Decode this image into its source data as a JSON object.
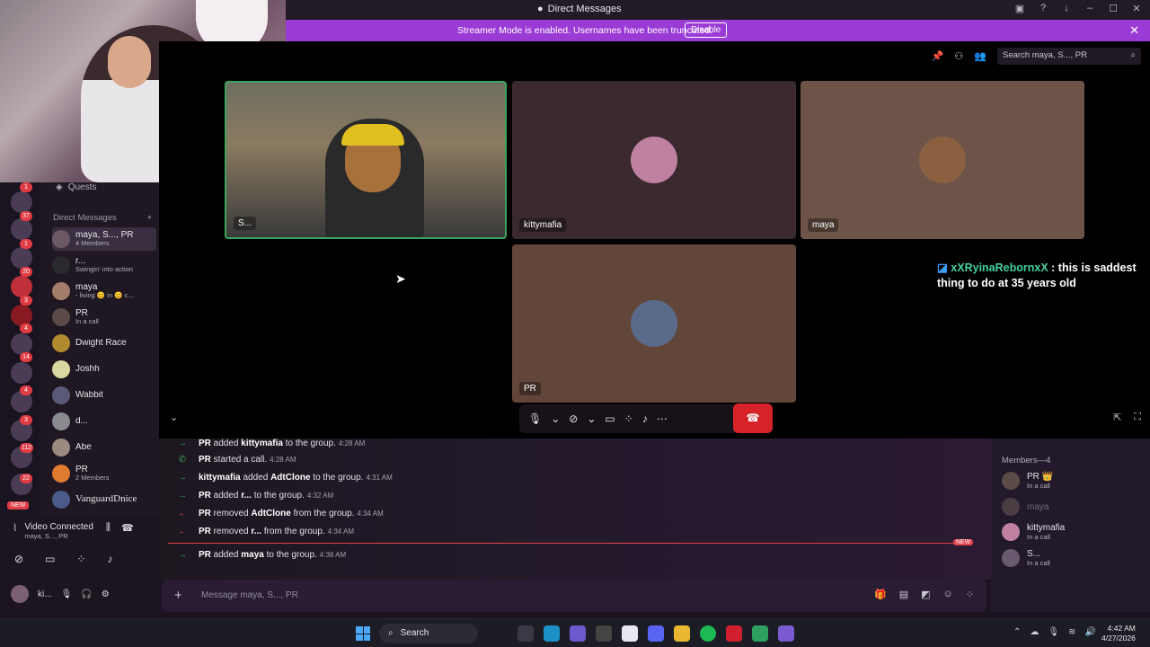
{
  "window": {
    "title": "Direct Messages"
  },
  "banner": {
    "message": "Streamer Mode is enabled. Usernames have been truncated.",
    "disable_label": "Disable"
  },
  "rail_badges": [
    "1",
    "37",
    "1",
    "20",
    "3",
    "4",
    "14",
    "4",
    "3",
    "112",
    "22"
  ],
  "rail_new_label": "NEW",
  "sidebar": {
    "quests_label": "Quests",
    "dm_header": "Direct Messages",
    "items": [
      {
        "name": "maya, S..., PR",
        "sub": "4 Members"
      },
      {
        "name": "r...",
        "sub": "Swingin' into action"
      },
      {
        "name": "maya",
        "sub": "- living 😊 in 😊 c..."
      },
      {
        "name": "PR",
        "sub": "In a call"
      },
      {
        "name": "Dwight Race",
        "sub": ""
      },
      {
        "name": "Joshh",
        "sub": ""
      },
      {
        "name": "Wabbit",
        "sub": ""
      },
      {
        "name": "d...",
        "sub": ""
      },
      {
        "name": "Abe",
        "sub": ""
      },
      {
        "name": "PR",
        "sub": "2 Members"
      },
      {
        "name": "VanguardDnice",
        "sub": ""
      }
    ]
  },
  "voice": {
    "status": "Video Connected",
    "channel": "maya, S..., PR"
  },
  "user": {
    "name": "ki..."
  },
  "call": {
    "search_placeholder": "Search maya, S..., PR",
    "tiles": [
      {
        "label": "S..."
      },
      {
        "label": "kittymafia"
      },
      {
        "label": "maya"
      },
      {
        "label": "PR"
      }
    ]
  },
  "stream_chat": {
    "user": "xXRyinaRebornxX",
    "text": " : this is saddest thing to do at 35 years old"
  },
  "messages": [
    {
      "actor": "PR",
      "action": " added ",
      "target": "kittymafia",
      "tail": " to the group.",
      "time": "4:28 AM",
      "arrow": "→"
    },
    {
      "actor": "PR",
      "action": " started a call.",
      "target": "",
      "tail": "",
      "time": "4:28 AM",
      "arrow": "✆"
    },
    {
      "actor": "kittymafia",
      "action": " added ",
      "target": "AdtClone",
      "tail": " to the group.",
      "time": "4:31 AM",
      "arrow": "→"
    },
    {
      "actor": "PR",
      "action": " added ",
      "target": "r...",
      "tail": " to the group.",
      "time": "4:32 AM",
      "arrow": "→"
    },
    {
      "actor": "PR",
      "action": " removed ",
      "target": "AdtClone",
      "tail": " from the group.",
      "time": "4:34 AM",
      "arrow": "←"
    },
    {
      "actor": "PR",
      "action": " removed ",
      "target": "r...",
      "tail": " from the group.",
      "time": "4:34 AM",
      "arrow": "←"
    },
    {
      "actor": "PR",
      "action": " added ",
      "target": "maya",
      "tail": " to the group.",
      "time": "4:38 AM",
      "arrow": "→"
    }
  ],
  "new_label": "NEW",
  "composer": {
    "placeholder": "Message maya, S..., PR"
  },
  "members": {
    "header": "Members—4",
    "list": [
      {
        "name": "PR 👑",
        "sub": "In a call"
      },
      {
        "name": "maya",
        "sub": ""
      },
      {
        "name": "kittymafia",
        "sub": "In a call"
      },
      {
        "name": "S...",
        "sub": "In a call"
      }
    ]
  },
  "taskbar": {
    "search_label": "Search",
    "time": "4:42 AM",
    "date": "4/27/2026"
  },
  "colors": {
    "accent": "#9b3bd6",
    "danger": "#d6232a",
    "chat_name": "#43d19d"
  }
}
